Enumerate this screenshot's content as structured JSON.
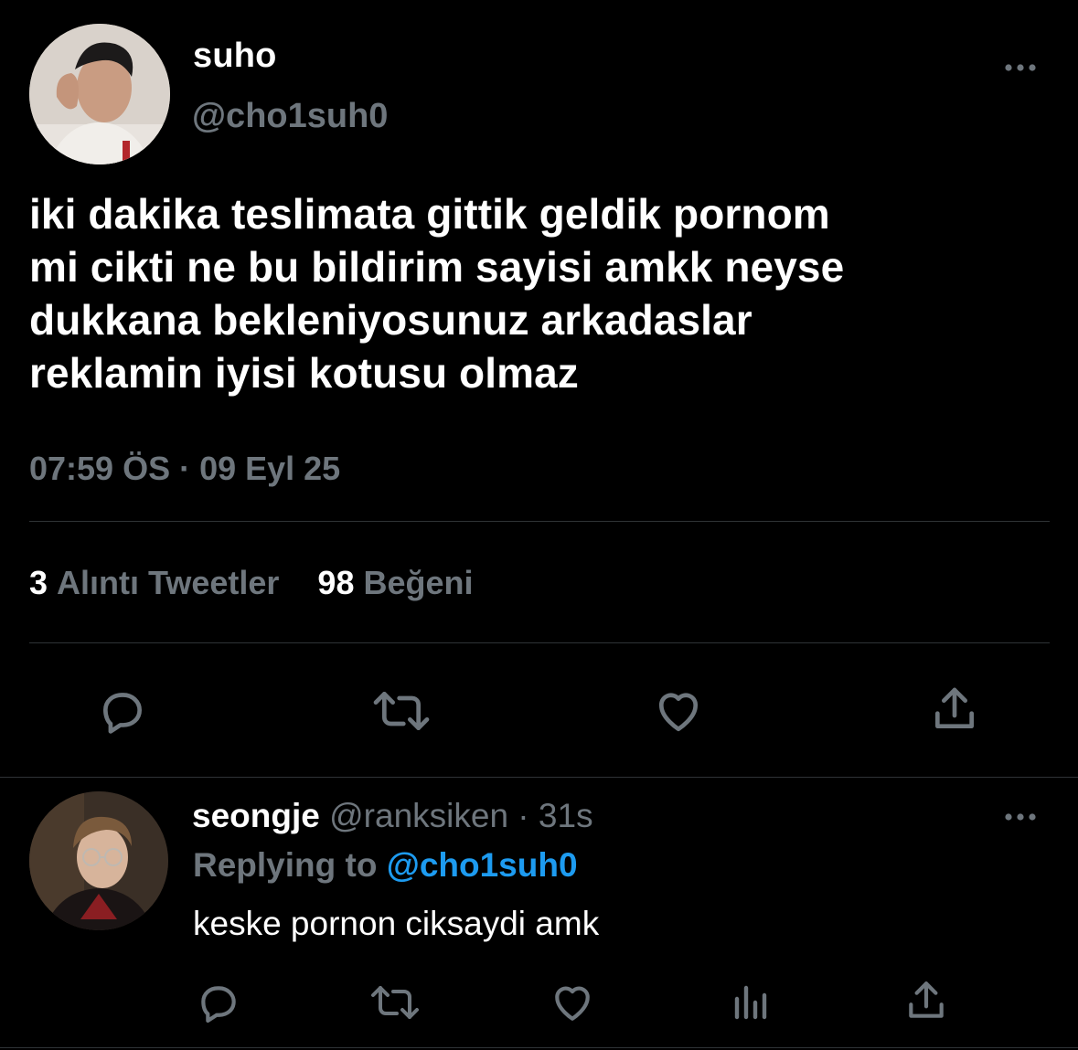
{
  "main_tweet": {
    "author_name": "suho",
    "author_handle": "@cho1suh0",
    "text": "iki dakika teslimata gittik geldik pornom\nmi cikti ne bu bildirim sayisi amkk neyse\ndukkana bekleniyosunuz arkadaslar\nreklamin iyisi kotusu olmaz",
    "timestamp": "07:59 ÖS · 09 Eyl 25",
    "stats": {
      "quote_count": "3",
      "quote_label": "Alıntı Tweetler",
      "like_count": "98",
      "like_label": "Beğeni"
    },
    "actions": [
      "reply-icon",
      "retweet-icon",
      "like-icon",
      "share-icon"
    ]
  },
  "reply": {
    "author_name": "seongje",
    "author_handle": "@ranksiken",
    "separator": " · ",
    "time": "31s",
    "replying_prefix": "Replying to ",
    "replying_to": "@cho1suh0",
    "text": "keske pornon ciksaydi amk",
    "actions": [
      "reply-icon",
      "retweet-icon",
      "like-icon",
      "stats-icon",
      "share-icon"
    ]
  },
  "colors": {
    "background": "#000000",
    "text_primary": "#ffffff",
    "text_secondary": "#6e767d",
    "link": "#1d9bf0",
    "divider": "#2f3336"
  }
}
